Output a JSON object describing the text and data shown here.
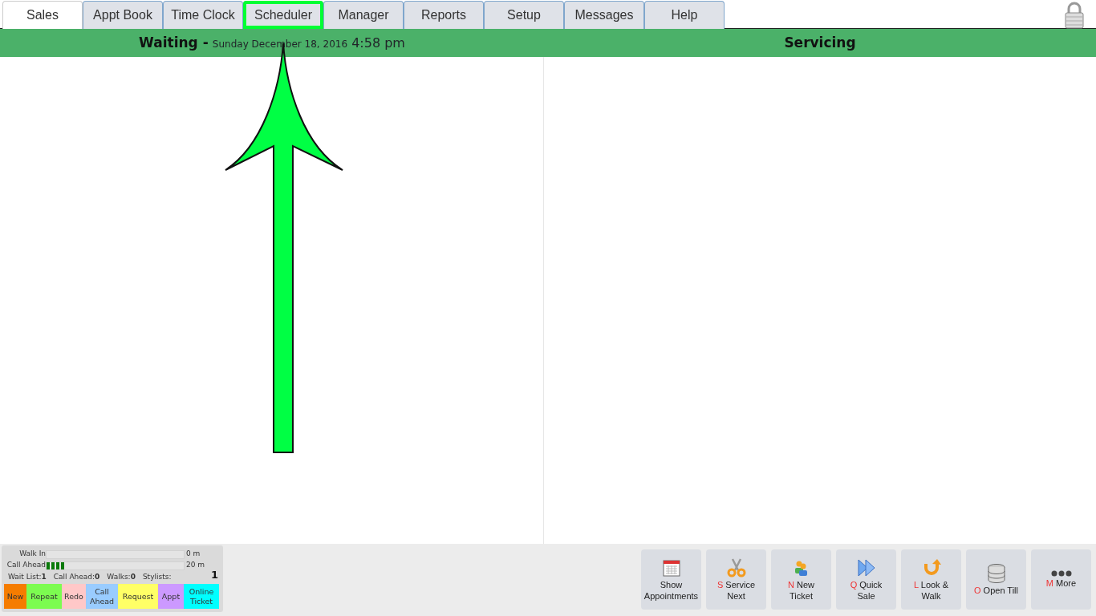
{
  "tabs": [
    {
      "label": "Sales",
      "selected": true,
      "highlighted": false
    },
    {
      "label": "Appt Book",
      "selected": false,
      "highlighted": false
    },
    {
      "label": "Time Clock",
      "selected": false,
      "highlighted": false
    },
    {
      "label": "Scheduler",
      "selected": false,
      "highlighted": true
    },
    {
      "label": "Manager",
      "selected": false,
      "highlighted": false
    },
    {
      "label": "Reports",
      "selected": false,
      "highlighted": false
    },
    {
      "label": "Setup",
      "selected": false,
      "highlighted": false
    },
    {
      "label": "Messages",
      "selected": false,
      "highlighted": false
    },
    {
      "label": "Help",
      "selected": false,
      "highlighted": false
    }
  ],
  "waiting_header": {
    "title": "Waiting -",
    "date": "Sunday December 18, 2016",
    "time": "4:58 pm"
  },
  "servicing_header": {
    "title": "Servicing"
  },
  "wait_panel": {
    "meters": [
      {
        "label": "Walk In",
        "level": 0,
        "reading": "0 m"
      },
      {
        "label": "Call Ahead",
        "level": 0.13,
        "reading": "20 m"
      }
    ],
    "stats": [
      {
        "label": "Wait List:",
        "value": "1"
      },
      {
        "label": "Call Ahead:",
        "value": "0"
      },
      {
        "label": "Walks:",
        "value": "0"
      },
      {
        "label": "Stylists:"
      }
    ],
    "stylists_count": "1",
    "legend": [
      {
        "label": "New",
        "color": "#f57c00"
      },
      {
        "label": "Repeat",
        "color": "#7cfc50"
      },
      {
        "label": "Redo",
        "color": "#ffc8c8"
      },
      {
        "label": "Call Ahead",
        "color": "#99ccff"
      },
      {
        "label": "Request",
        "color": "#ffff66"
      },
      {
        "label": "Appt",
        "color": "#cc99ff"
      },
      {
        "label": "Online Ticket",
        "color": "#00ffff"
      }
    ]
  },
  "actions": [
    {
      "kind": "calendar",
      "label": "Show Appointments"
    },
    {
      "kind": "scissors",
      "key": "S",
      "label": "Service Next"
    },
    {
      "kind": "people",
      "key": "N",
      "label": "New Ticket"
    },
    {
      "kind": "forward",
      "key": "Q",
      "label": "Quick Sale"
    },
    {
      "kind": "return",
      "key": "L",
      "label": "Look & Walk"
    },
    {
      "kind": "database",
      "key": "O",
      "label": "Open Till"
    },
    {
      "kind": "dots",
      "key": "M",
      "label": "More"
    }
  ]
}
